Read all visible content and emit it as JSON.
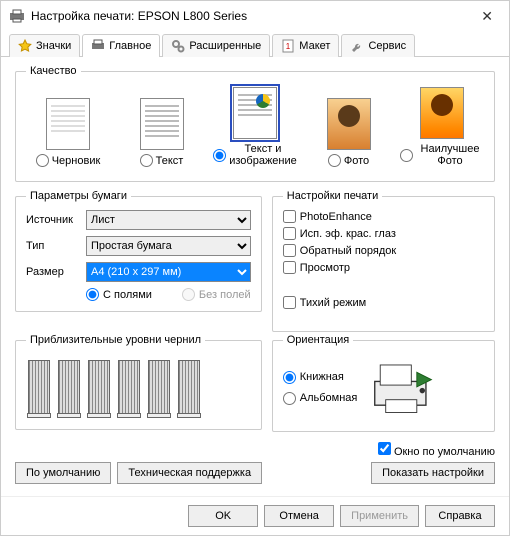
{
  "window": {
    "title": "Настройка печати: EPSON L800 Series"
  },
  "tabs": {
    "icons": "Значки",
    "main": "Главное",
    "advanced": "Расширенные",
    "layout": "Макет",
    "service": "Сервис"
  },
  "quality": {
    "legend": "Качество",
    "draft": "Черновик",
    "text": "Текст",
    "text_image": "Текст и изображение",
    "photo": "Фото",
    "best_photo": "Наилучшее Фото",
    "selected": "text_image"
  },
  "paper": {
    "legend": "Параметры бумаги",
    "source_label": "Источник",
    "source_value": "Лист",
    "type_label": "Тип",
    "type_value": "Простая бумага",
    "size_label": "Размер",
    "size_value": "A4 (210 x 297 мм)",
    "with_margins": "С полями",
    "borderless": "Без полей"
  },
  "print_settings": {
    "legend": "Настройки печати",
    "photoenhance": "PhotoEnhance",
    "redeye": "Исп. эф. крас. глаз",
    "reverse": "Обратный порядок",
    "preview": "Просмотр",
    "quiet": "Тихий режим"
  },
  "ink": {
    "legend": "Приблизительные уровни чернил"
  },
  "orientation": {
    "legend": "Ориентация",
    "portrait": "Книжная",
    "landscape": "Альбомная"
  },
  "footer": {
    "default_window": "Окно по умолчанию",
    "default_btn": "По умолчанию",
    "support_btn": "Техническая поддержка",
    "show_settings": "Показать настройки"
  },
  "buttons": {
    "ok": "OK",
    "cancel": "Отмена",
    "apply": "Применить",
    "help": "Справка"
  }
}
